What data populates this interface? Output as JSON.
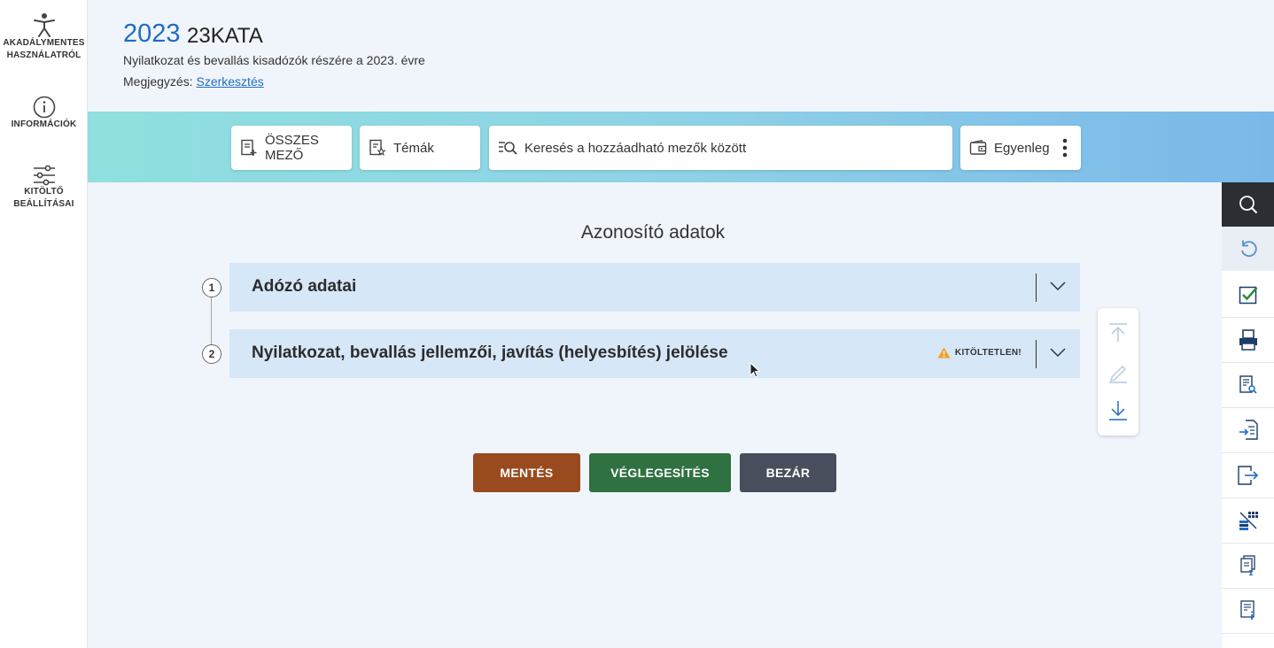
{
  "left_sidebar": {
    "items": [
      {
        "label_line1": "AKADÁLYMENTES",
        "label_line2": "HASZNÁLATRÓL",
        "icon": "accessibility-icon"
      },
      {
        "label_line1": "INFORMÁCIÓK",
        "label_line2": "",
        "icon": "info-icon"
      },
      {
        "label_line1": "KITÖLTŐ",
        "label_line2": "BEÁLLÍTÁSAI",
        "icon": "sliders-icon"
      }
    ]
  },
  "header": {
    "year": "2023",
    "form_code": "23KATA",
    "subtitle": "Nyilatkozat és bevallás kisadózók részére a 2023. évre",
    "note_label": "Megjegyzés:",
    "note_link": "Szerkesztés"
  },
  "toolbar": {
    "all_fields": "ÖSSZES MEZŐ",
    "topics": "Témák",
    "search_placeholder": "Keresés a hozzáadható mezők között",
    "balance": "Egyenleg"
  },
  "main": {
    "section_title": "Azonosító adatok",
    "panels": [
      {
        "number": "1",
        "title": "Adózó adatai",
        "warning": ""
      },
      {
        "number": "2",
        "title": "Nyilatkozat, bevallás jellemzői, javítás (helyesbítés) jelölése",
        "warning": "KITÖLTETLEN!"
      }
    ]
  },
  "actions": {
    "save": "MENTÉS",
    "finalize": "VÉGLEGESÍTÉS",
    "close": "BEZÁR"
  },
  "colors": {
    "accent_blue": "#1f6dc2",
    "save_btn": "#9a4a1f",
    "finalize_btn": "#2f7140",
    "close_btn": "#484e5c",
    "warning": "#f0a020"
  }
}
